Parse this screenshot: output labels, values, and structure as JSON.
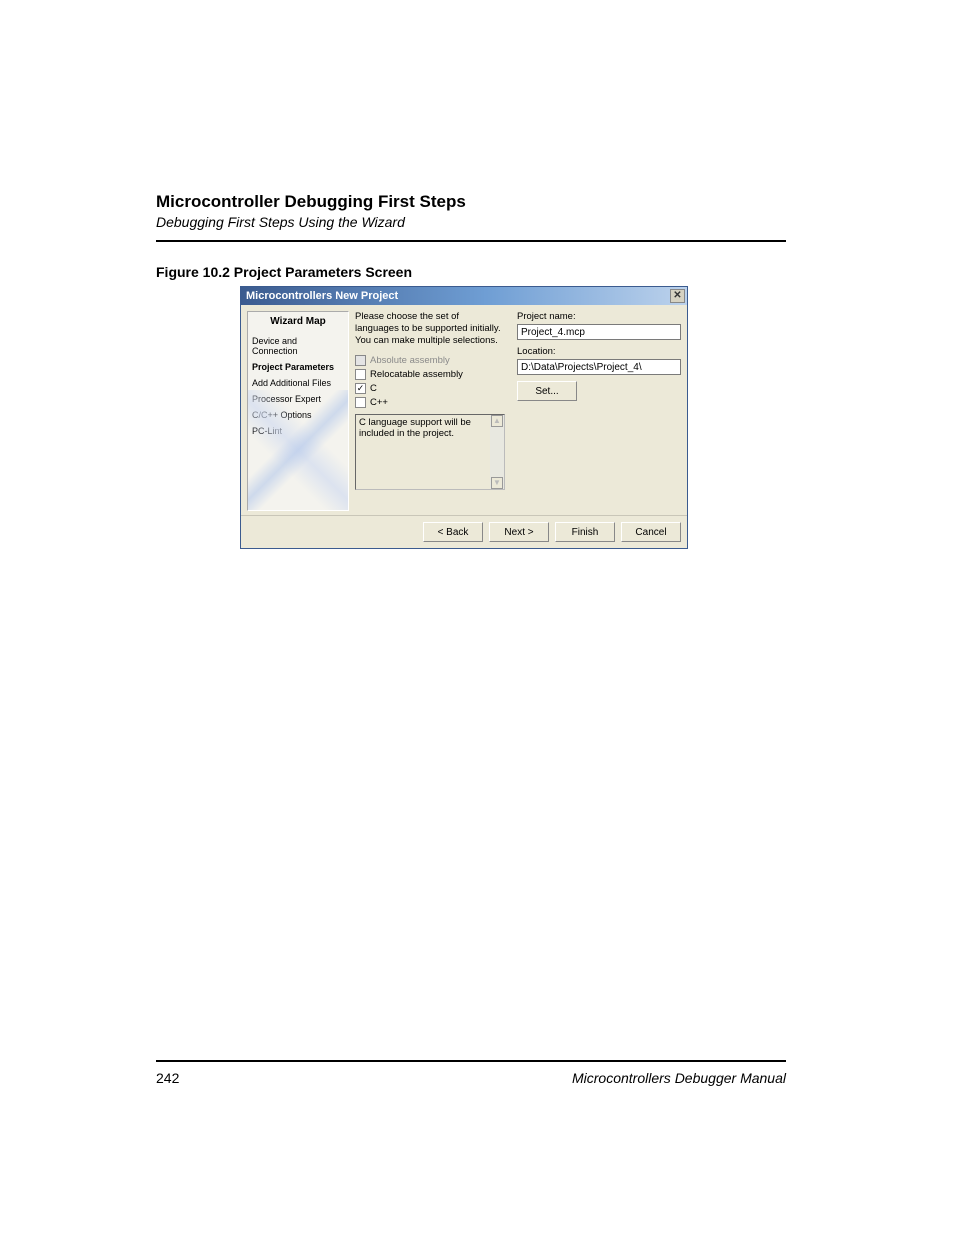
{
  "header": {
    "chapter_title": "Microcontroller Debugging First Steps",
    "section_title": "Debugging First Steps Using the Wizard"
  },
  "figure": {
    "caption": "Figure 10.2  Project Parameters Screen"
  },
  "dialog": {
    "title": "Microcontrollers New Project",
    "close": "✕",
    "sidebar": {
      "heading": "Wizard Map",
      "items": [
        {
          "label": "Device and Connection",
          "active": false
        },
        {
          "label": "Project Parameters",
          "active": true
        },
        {
          "label": "Add Additional Files",
          "active": false
        },
        {
          "label": "Processor Expert",
          "active": false
        },
        {
          "label": "C/C++ Options",
          "active": false
        },
        {
          "label": "PC-Lint",
          "active": false
        }
      ]
    },
    "instructions": "Please choose the set of languages to be supported initially. You can make multiple selections.",
    "languages": {
      "absolute_assembly": {
        "label": "Absolute assembly",
        "checked": false,
        "disabled": true
      },
      "relocatable_assembly": {
        "label": "Relocatable assembly",
        "checked": false,
        "disabled": false
      },
      "c": {
        "label": "C",
        "checked": true,
        "disabled": false
      },
      "cpp": {
        "label": "C++",
        "checked": false,
        "disabled": false
      }
    },
    "description": "C language support will be included in the project.",
    "project_name_label": "Project name:",
    "project_name_value": "Project_4.mcp",
    "location_label": "Location:",
    "location_value": "D:\\Data\\Projects\\Project_4\\",
    "set_button": "Set...",
    "buttons": {
      "back": "< Back",
      "next": "Next >",
      "finish": "Finish",
      "cancel": "Cancel"
    }
  },
  "footer": {
    "page_number": "242",
    "manual_title": "Microcontrollers Debugger Manual"
  }
}
